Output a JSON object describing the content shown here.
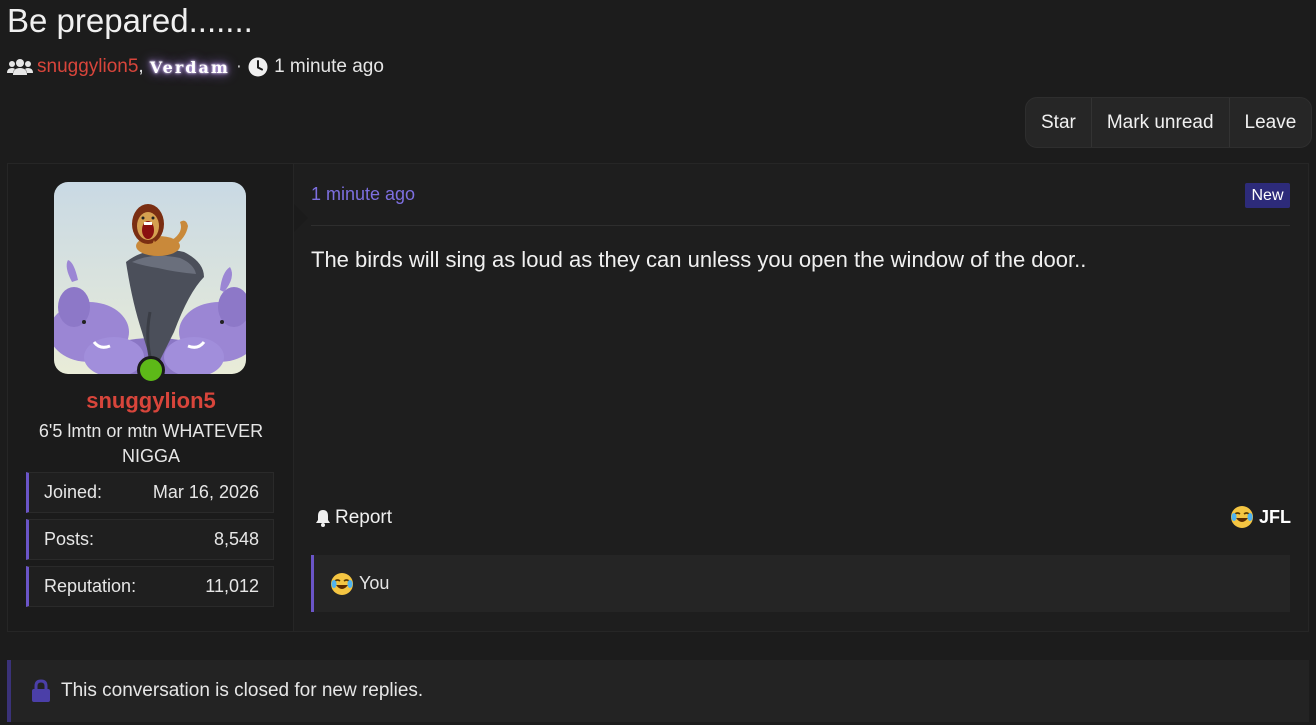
{
  "thread": {
    "title": "Be prepared.......",
    "participants": [
      "snuggylion5",
      "Verdam"
    ],
    "time_ago": "1 minute ago"
  },
  "actions": {
    "star": "Star",
    "mark_unread": "Mark unread",
    "leave": "Leave"
  },
  "post": {
    "author": {
      "name": "snuggylion5",
      "title": "6'5 lmtn or mtn WHATEVER NIGGA",
      "stats": [
        {
          "label": "Joined:",
          "value": "Mar 16, 2026"
        },
        {
          "label": "Posts:",
          "value": "8,548"
        },
        {
          "label": "Reputation:",
          "value": "11,012"
        }
      ],
      "online": true
    },
    "time": "1 minute ago",
    "badge": "New",
    "message": "The birds will sing as loud as they can unless you open the window of the door..",
    "report_label": "Report",
    "reaction_label": "JFL",
    "reactions_list": "You"
  },
  "closed_notice": "This conversation is closed for new replies.",
  "colors": {
    "accent": "#6b55c8",
    "username": "#d8453b",
    "online": "#5db918",
    "badge": "#2d2b7a"
  }
}
